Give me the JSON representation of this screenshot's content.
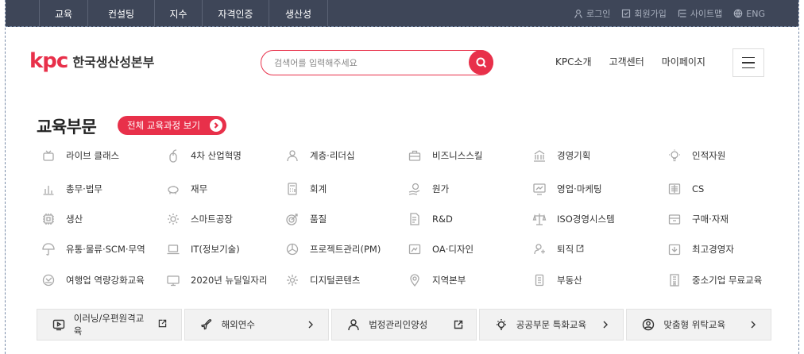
{
  "topnav": [
    "교육",
    "컨설팅",
    "지수",
    "자격인증",
    "생산성"
  ],
  "util": [
    {
      "label": "로그인",
      "icon": "user-icon"
    },
    {
      "label": "회원가입",
      "icon": "signup-icon"
    },
    {
      "label": "사이트맵",
      "icon": "sitemap-icon"
    },
    {
      "label": "ENG",
      "icon": "globe-icon"
    }
  ],
  "logo": {
    "mark": "kpc",
    "text": "한국생산성본부"
  },
  "search": {
    "placeholder": "검색어를 입력해주세요"
  },
  "header_links": [
    "KPC소개",
    "고객센터",
    "마이페이지"
  ],
  "section": {
    "title": "교육부문",
    "all_button": "전체 교육과정 보기"
  },
  "categories": [
    [
      "라이브 클래스",
      "4차 산업혁명",
      "계층·리더십",
      "비즈니스스킬",
      "경영기획",
      "인적자원"
    ],
    [
      "총무·법무",
      "재무",
      "회계",
      "원가",
      "영업·마케팅",
      "CS"
    ],
    [
      "생산",
      "스마트공장",
      "품질",
      "R&D",
      "ISO경영시스템",
      "구매·자재"
    ],
    [
      "유통·물류·SCM·무역",
      "IT(정보기술)",
      "프로젝트관리(PM)",
      "OA·디자인",
      "퇴직",
      "최고경영자"
    ],
    [
      "여행업 역량강화교육",
      "2020년 뉴딜일자리",
      "디지털콘텐츠",
      "지역본부",
      "부동산",
      "중소기업 무료교육"
    ]
  ],
  "bottom_links": [
    "이러닝/우편원격교육",
    "해외연수",
    "법정관리인양성",
    "공공부문 특화교육",
    "맞춤형 위탁교육"
  ],
  "colors": {
    "accent": "#e8304a",
    "topbar": "#3e4658"
  }
}
